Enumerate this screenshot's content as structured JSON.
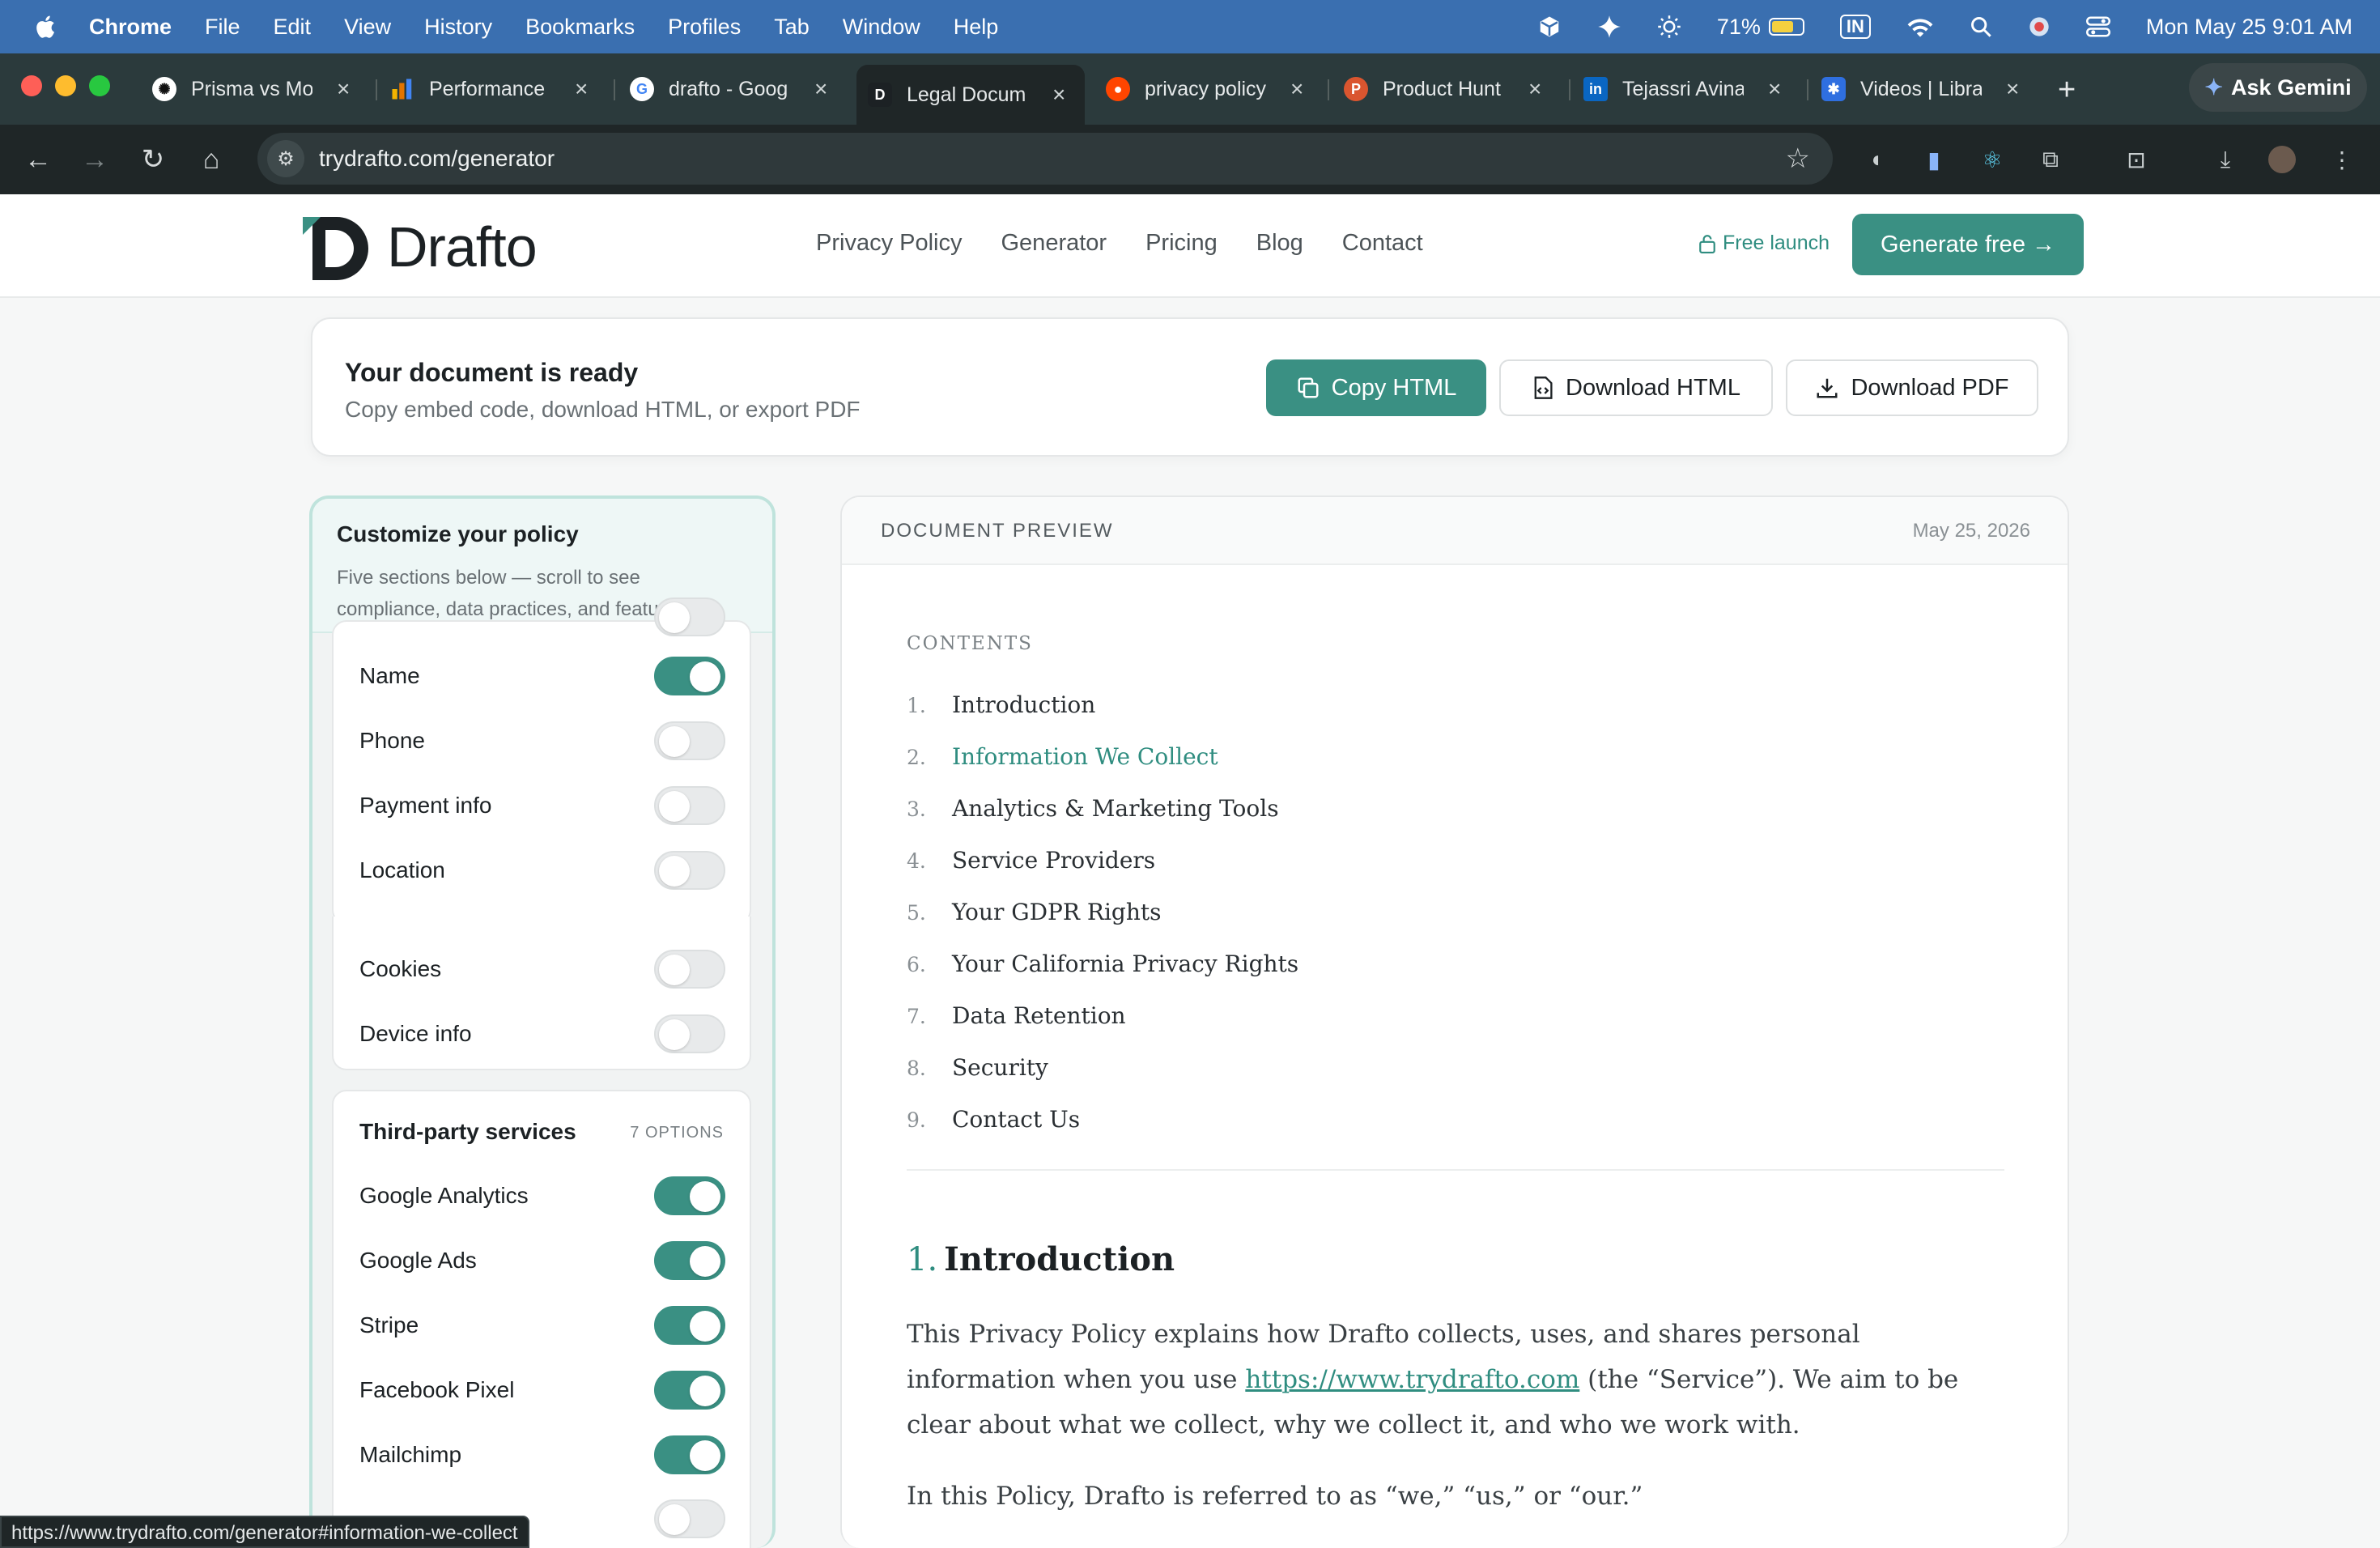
{
  "menubar": {
    "app": "Chrome",
    "items": [
      "File",
      "Edit",
      "View",
      "History",
      "Bookmarks",
      "Profiles",
      "Tab",
      "Window",
      "Help"
    ],
    "battery": "71%",
    "input_badge": "IN",
    "datetime": "Mon May 25  9:01 AM"
  },
  "tabs": [
    {
      "title": "Prisma vs Mo",
      "icon": "openai-icon",
      "color": "#ffffff"
    },
    {
      "title": "Performance",
      "icon": "chart-icon",
      "color": "#f4b400"
    },
    {
      "title": "drafto - Goog",
      "icon": "google-icon",
      "color": "#ffffff"
    },
    {
      "title": "Legal Docum",
      "icon": "drafto-icon",
      "color": "#1c2124"
    },
    {
      "title": "privacy policy",
      "icon": "reddit-icon",
      "color": "#ff4500"
    },
    {
      "title": "Product Hunt",
      "icon": "producthunt-icon",
      "color": "#da552f"
    },
    {
      "title": "Tejassri Avina",
      "icon": "linkedin-icon",
      "color": "#0a66c2"
    },
    {
      "title": "Videos | Libra",
      "icon": "asterisk-icon",
      "color": "#2f6fe0"
    }
  ],
  "gemini_label": "Ask Gemini",
  "address": {
    "url": "trydrafto.com/generator"
  },
  "site": {
    "brand": "Drafto",
    "nav": [
      "Privacy Policy",
      "Generator",
      "Pricing",
      "Blog",
      "Contact"
    ],
    "free_launch": "Free launch",
    "cta": "Generate free →"
  },
  "ready": {
    "title": "Your document is ready",
    "subtitle": "Copy embed code, download HTML, or export PDF",
    "copy_html": "Copy HTML",
    "download_html": "Download HTML",
    "download_pdf": "Download PDF"
  },
  "customize": {
    "title": "Customize your policy",
    "subtitle": "Five sections below — scroll to see compliance, data practices, and features.",
    "data_items": [
      {
        "label": "Name",
        "on": true
      },
      {
        "label": "Phone",
        "on": false
      },
      {
        "label": "Payment info",
        "on": false
      },
      {
        "label": "Location",
        "on": false
      },
      {
        "label": "Cookies",
        "on": false
      },
      {
        "label": "Device info",
        "on": false
      }
    ],
    "third_party": {
      "title": "Third-party services",
      "meta": "7 OPTIONS",
      "items": [
        {
          "label": "Google Analytics",
          "on": true
        },
        {
          "label": "Google Ads",
          "on": true
        },
        {
          "label": "Stripe",
          "on": true
        },
        {
          "label": "Facebook Pixel",
          "on": true
        },
        {
          "label": "Mailchimp",
          "on": true
        }
      ]
    }
  },
  "preview": {
    "label": "DOCUMENT PREVIEW",
    "date": "May 25, 2026",
    "contents_label": "CONTENTS",
    "toc": [
      {
        "n": "1.",
        "t": "Introduction"
      },
      {
        "n": "2.",
        "t": "Information We Collect"
      },
      {
        "n": "3.",
        "t": "Analytics & Marketing Tools"
      },
      {
        "n": "4.",
        "t": "Service Providers"
      },
      {
        "n": "5.",
        "t": "Your GDPR Rights"
      },
      {
        "n": "6.",
        "t": "Your California Privacy Rights"
      },
      {
        "n": "7.",
        "t": "Data Retention"
      },
      {
        "n": "8.",
        "t": "Security"
      },
      {
        "n": "9.",
        "t": "Contact Us"
      }
    ],
    "section1": {
      "num": "1.",
      "title": "Introduction",
      "p1_a": "This Privacy Policy explains how Drafto collects, uses, and shares personal information when you use ",
      "p1_link": "https://www.trydrafto.com",
      "p1_b": " (the “Service”). We aim to be clear about what we collect, why we collect it, and who we work with.",
      "p2": "In this Policy, Drafto is referred to as “we,” “us,” or “our.”"
    }
  },
  "status_url": "https://www.trydrafto.com/generator#information-we-collect"
}
